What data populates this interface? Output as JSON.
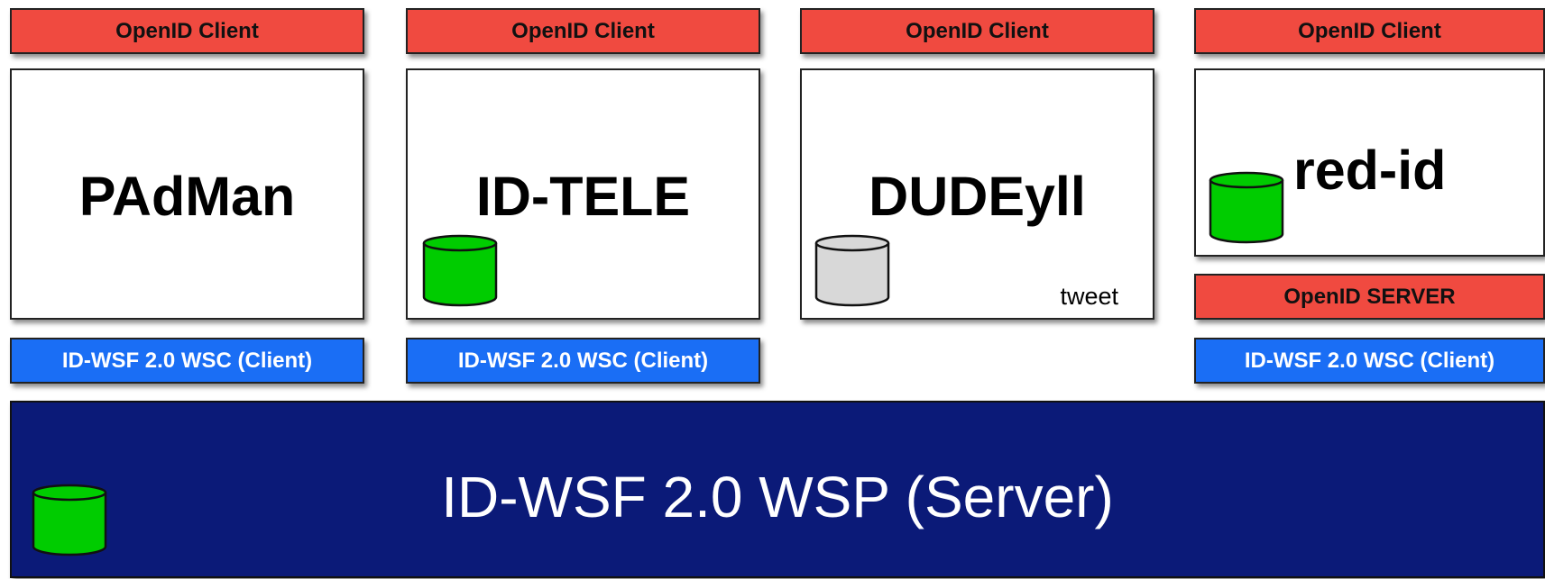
{
  "columns": [
    {
      "openid_client": "OpenID Client",
      "app_name": "PAdMan",
      "wsc": "ID-WSF 2.0  WSC (Client)"
    },
    {
      "openid_client": "OpenID Client",
      "app_name": "ID-TELE",
      "wsc": "ID-WSF 2.0  WSC (Client)"
    },
    {
      "openid_client": "OpenID Client",
      "app_name": "DUDEyll",
      "note": "tweet"
    },
    {
      "openid_client": "OpenID Client",
      "app_name": "red-id",
      "openid_server": "OpenID SERVER",
      "wsc": "ID-WSF 2.0  WSC (Client)"
    }
  ],
  "wsp": {
    "label": "ID-WSF 2.0 WSP (Server)"
  },
  "colors": {
    "openid": "#f04a40",
    "wsc": "#1a6ef5",
    "wsp": "#0b1a78",
    "db_active": "#00cc00",
    "db_inactive": "#d8d8d8"
  },
  "icons": {
    "database": "database-icon"
  }
}
